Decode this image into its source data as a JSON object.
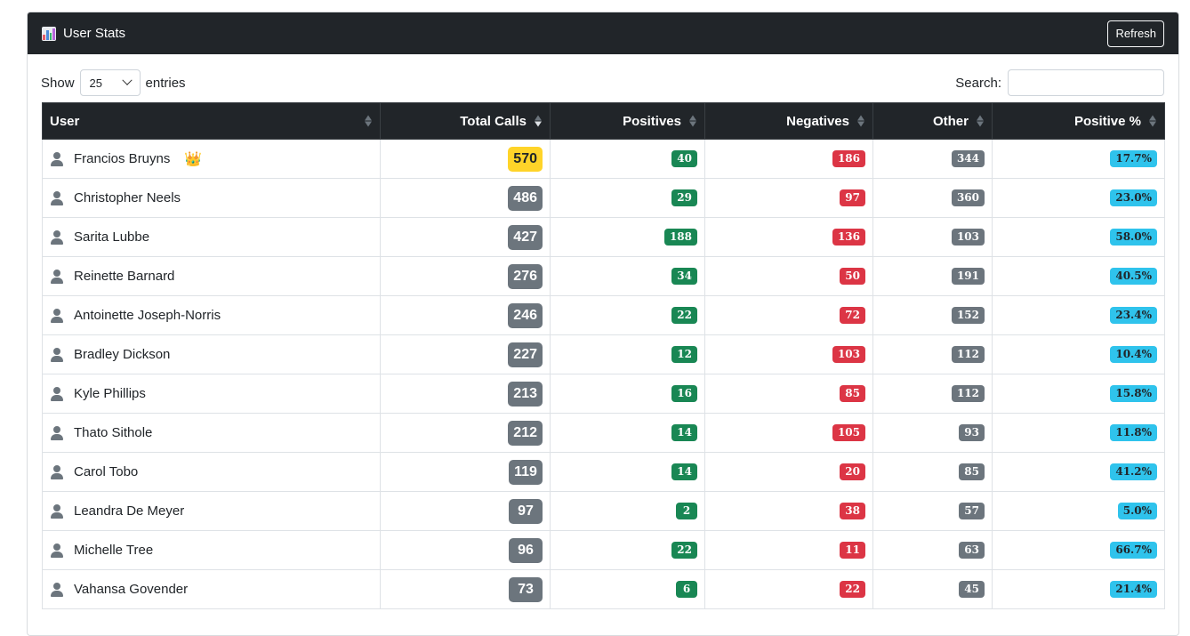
{
  "header": {
    "title": "User Stats",
    "refresh_label": "Refresh"
  },
  "toolbar": {
    "show_label": "Show",
    "page_size": "25",
    "entries_label": "entries",
    "search_label": "Search:",
    "search_value": ""
  },
  "table": {
    "columns": [
      "User",
      "Total Calls",
      "Positives",
      "Negatives",
      "Other",
      "Positive %"
    ],
    "rows": [
      {
        "user": "Francios Bruyns",
        "total": "570",
        "pos": "40",
        "neg": "186",
        "other": "344",
        "pct": "17.7%",
        "top": true
      },
      {
        "user": "Christopher Neels",
        "total": "486",
        "pos": "29",
        "neg": "97",
        "other": "360",
        "pct": "23.0%"
      },
      {
        "user": "Sarita Lubbe",
        "total": "427",
        "pos": "188",
        "neg": "136",
        "other": "103",
        "pct": "58.0%"
      },
      {
        "user": "Reinette Barnard",
        "total": "276",
        "pos": "34",
        "neg": "50",
        "other": "191",
        "pct": "40.5%"
      },
      {
        "user": "Antoinette Joseph-Norris",
        "total": "246",
        "pos": "22",
        "neg": "72",
        "other": "152",
        "pct": "23.4%"
      },
      {
        "user": "Bradley Dickson",
        "total": "227",
        "pos": "12",
        "neg": "103",
        "other": "112",
        "pct": "10.4%"
      },
      {
        "user": "Kyle Phillips",
        "total": "213",
        "pos": "16",
        "neg": "85",
        "other": "112",
        "pct": "15.8%"
      },
      {
        "user": "Thato Sithole",
        "total": "212",
        "pos": "14",
        "neg": "105",
        "other": "93",
        "pct": "11.8%"
      },
      {
        "user": "Carol Tobo",
        "total": "119",
        "pos": "14",
        "neg": "20",
        "other": "85",
        "pct": "41.2%"
      },
      {
        "user": "Leandra De Meyer",
        "total": "97",
        "pos": "2",
        "neg": "38",
        "other": "57",
        "pct": "5.0%"
      },
      {
        "user": "Michelle Tree",
        "total": "96",
        "pos": "22",
        "neg": "11",
        "other": "63",
        "pct": "66.7%"
      },
      {
        "user": "Vahansa Govender",
        "total": "73",
        "pos": "6",
        "neg": "22",
        "other": "45",
        "pct": "21.4%"
      }
    ]
  },
  "icons": {
    "title_icon": "bar-chart-icon",
    "user_icon": "person-icon",
    "top_user_icon": "crown-icon",
    "select_icon": "chevron-down-icon"
  },
  "colors": {
    "header_bg": "#212529",
    "positive": "#198754",
    "negative": "#dc3545",
    "neutral": "#6c757d",
    "percent": "#2fc3ec",
    "top_calls": "#ffd429",
    "crown": "#f5c518"
  }
}
